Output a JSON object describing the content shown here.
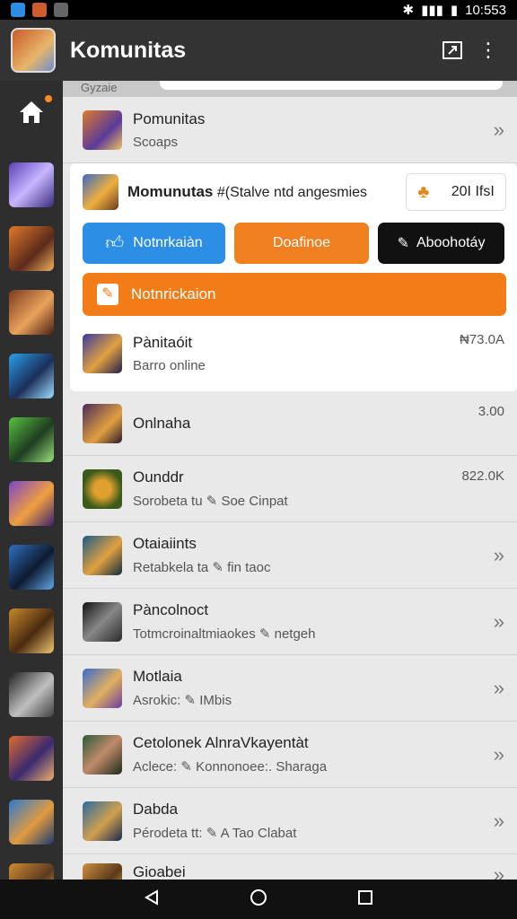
{
  "status": {
    "time": "10:553"
  },
  "app": {
    "title": "Komunitas"
  },
  "search": {
    "label": "Gyzaie"
  },
  "rows_top": [
    {
      "title": "Pomunitas",
      "sub": "Scoaps"
    }
  ],
  "card": {
    "title_bold": "Momunutas",
    "title_rest": " #(Stalve ntd angesmies",
    "pill_value": "20I IfsI",
    "btn_blue": "Notnrkaiàn",
    "btn_orange": "Doafinoe",
    "btn_black": "Aboohotáy",
    "btn_wide": "Notnrickaion",
    "inner_row": {
      "title": "Pànitaóit",
      "sub": "Barro online",
      "right": "₦73.0A"
    }
  },
  "rows": [
    {
      "title": "Onlnaha",
      "sub": "",
      "right": "3.00"
    },
    {
      "title": "Ounddr",
      "sub": "Sorobeta tu ✎ Soe Cinpat",
      "right": "822.0K"
    },
    {
      "title": "Otaiaiints",
      "sub": "Retabkela ta ✎ fin taoc",
      "right": "»"
    },
    {
      "title": "Pàncolnoct",
      "sub": "Totmcroinaltmiaokes ✎ netgeh",
      "right": "»"
    },
    {
      "title": "Motlaia",
      "sub": "Asrokic: ✎ IMbis",
      "right": "»"
    },
    {
      "title": "Cetolonek AlnraVkayentàt",
      "sub": "Aclece: ✎ Konnonoee:. Sharaga",
      "right": "»"
    },
    {
      "title": "Dabda",
      "sub": "Pérodeta tt: ✎ A Tao Clabat",
      "right": "»"
    },
    {
      "title": "Gioabei",
      "sub": "",
      "right": "»"
    }
  ],
  "colors": {
    "accent_orange": "#f27d18",
    "accent_blue": "#2c8fe5"
  }
}
